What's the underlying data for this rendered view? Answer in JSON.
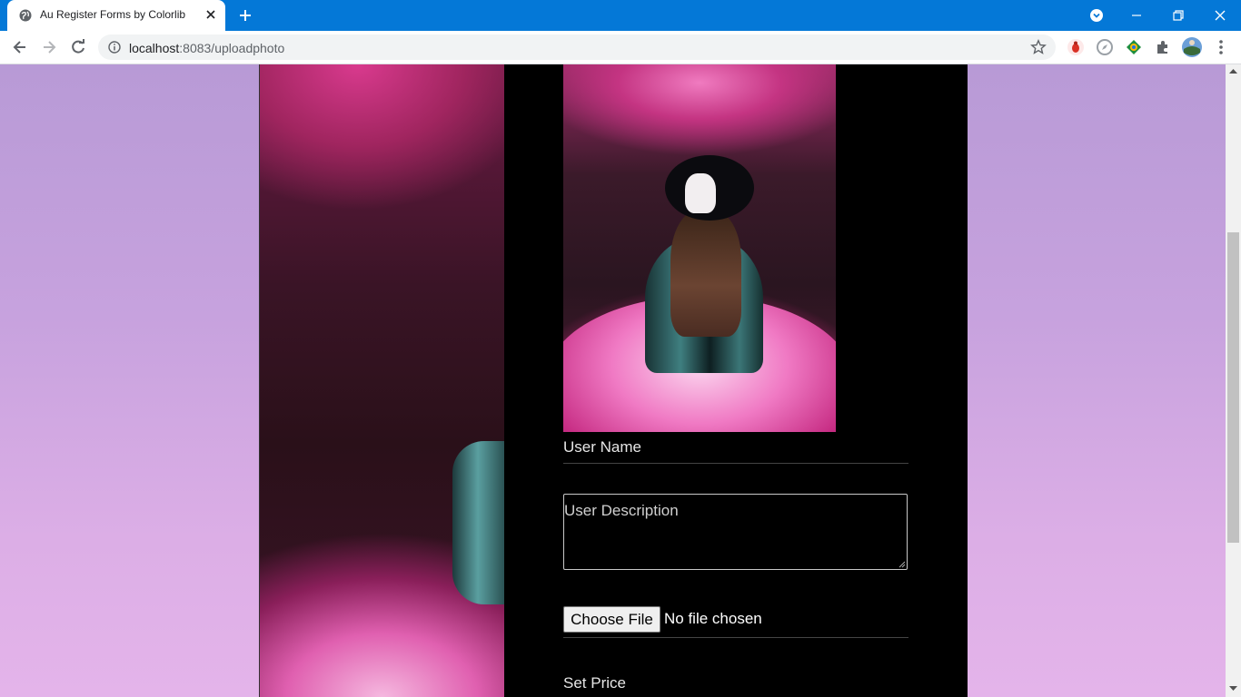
{
  "browser": {
    "tab": {
      "title": "Au Register Forms by Colorlib"
    },
    "address": {
      "host": "localhost",
      "port_path": ":8083/uploadphoto"
    },
    "colors": {
      "titlebar": "#0478d7",
      "toolbar": "#ffffff"
    }
  },
  "page": {
    "form": {
      "user_name_label": "User Name",
      "user_description_placeholder": "User Description",
      "file_button_label": "Choose File",
      "file_status": "No file chosen",
      "set_price_label": "Set Price"
    },
    "colors": {
      "background_top": "#b89ad6",
      "background_bottom": "#e4b4ea",
      "card": "#000000",
      "smoke_accent": "#e060b0"
    }
  }
}
